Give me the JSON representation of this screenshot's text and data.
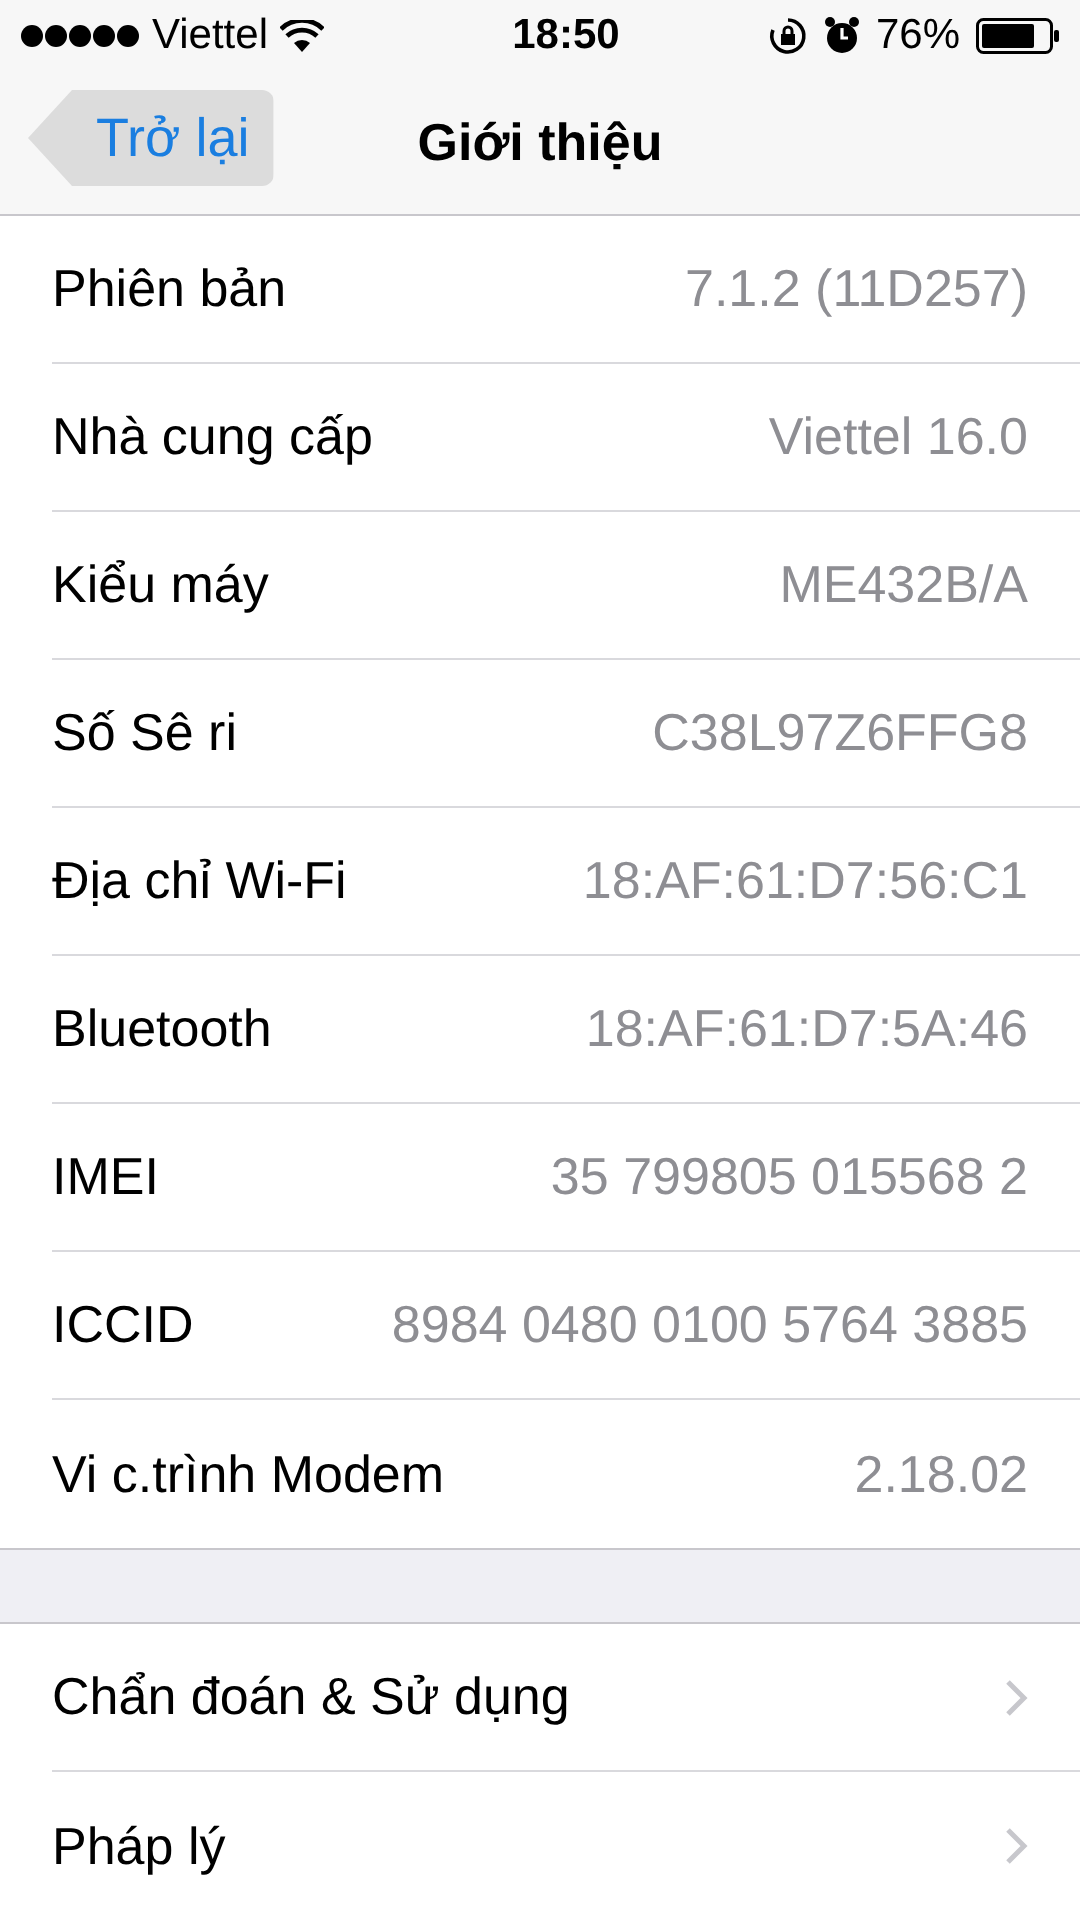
{
  "status_bar": {
    "carrier": "Viettel",
    "time": "18:50",
    "battery": "76%"
  },
  "nav": {
    "back": {
      "label": "Trở lại",
      "pressed": true
    },
    "title": "Giới thiệu"
  },
  "info_rows": [
    {
      "label": "Phiên bản",
      "value": "7.1.2 (11D257)"
    },
    {
      "label": "Nhà cung cấp",
      "value": "Viettel 16.0"
    },
    {
      "label": "Kiểu máy",
      "value": "ME432B/A"
    },
    {
      "label": "Số Sê ri",
      "value": "C38L97Z6FFG8"
    },
    {
      "label": "Địa chỉ Wi-Fi",
      "value": "18:AF:61:D7:56:C1"
    },
    {
      "label": "Bluetooth",
      "value": "18:AF:61:D7:5A:46"
    },
    {
      "label": "IMEI",
      "value": "35 799805 015568 2"
    },
    {
      "label": "ICCID",
      "value": "8984 0480 0100 5764 3885"
    },
    {
      "label": "Vi c.trình Modem",
      "value": "2.18.02"
    }
  ],
  "link_rows": [
    {
      "label": "Chẩn đoán & Sử dụng"
    },
    {
      "label": "Pháp lý"
    }
  ]
}
